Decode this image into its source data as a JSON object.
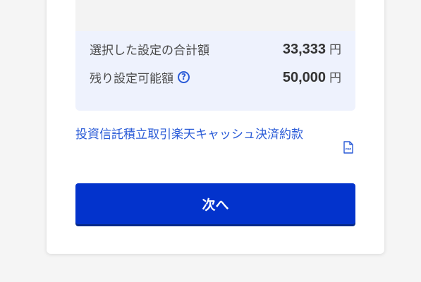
{
  "summary": {
    "selected_total_label": "選択した設定の合計額",
    "selected_total_amount": "33,333",
    "selected_total_unit": "円",
    "remaining_label": "残り設定可能額",
    "remaining_amount": "50,000",
    "remaining_unit": "円",
    "help_icon_glyph": "?"
  },
  "terms": {
    "link_text": "投資信託積立取引楽天キャッシュ決済約款",
    "pdf_icon_text": "PDF"
  },
  "actions": {
    "next_label": "次へ"
  },
  "colors": {
    "primary_button": "#0333cc",
    "link": "#2a5bd7",
    "summary_background": "#eef2fd"
  }
}
